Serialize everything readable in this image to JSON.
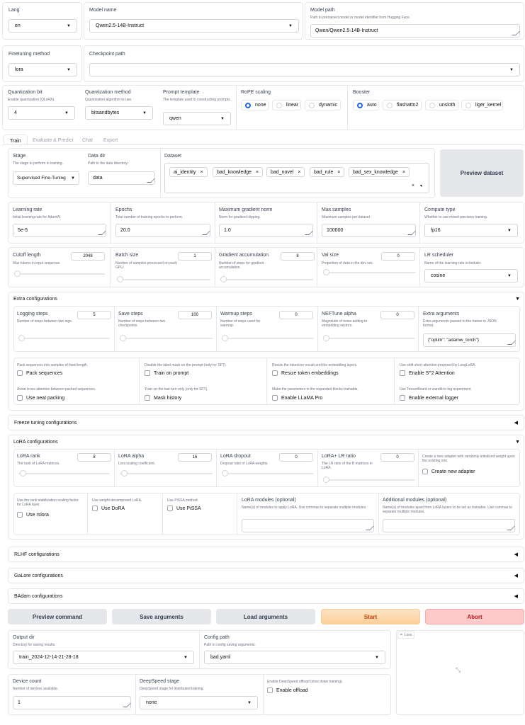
{
  "top": {
    "lang": {
      "label": "Lang",
      "value": "en"
    },
    "model_name": {
      "label": "Model name",
      "value": "Qwen2.5-14B-Instruct"
    },
    "model_path": {
      "label": "Model path",
      "desc": "Path to pretrained model or model identifier from Hugging Face.",
      "value": "Qwen/Qwen2.5-14B-Instruct"
    },
    "finetuning": {
      "label": "Finetuning method",
      "value": "lora"
    },
    "checkpoint": {
      "label": "Checkpoint path",
      "value": ""
    },
    "quant_bit": {
      "label": "Quantization bit",
      "desc": "Enable quantization (QLoRA).",
      "value": "4"
    },
    "quant_method": {
      "label": "Quantization method",
      "desc": "Quantization algorithm to use.",
      "value": "bitsandbytes"
    },
    "template": {
      "label": "Prompt template",
      "desc": "The template used in constructing prompts.",
      "value": "qwen"
    },
    "rope": {
      "label": "RoPE scaling",
      "options": [
        "none",
        "linear",
        "dynamic"
      ],
      "selected": "none"
    },
    "booster": {
      "label": "Booster",
      "options": [
        "auto",
        "flashattn2",
        "unsloth",
        "liger_kernel"
      ],
      "selected": "auto"
    }
  },
  "tabs": [
    "Train",
    "Evaluate & Predict",
    "Chat",
    "Export"
  ],
  "train": {
    "stage": {
      "label": "Stage",
      "desc": "The stage to perform in training.",
      "value": "Supervised Fine-Tuning"
    },
    "data_dir": {
      "label": "Data dir",
      "desc": "Path to the data directory.",
      "value": "data"
    },
    "dataset": {
      "label": "Dataset",
      "tags": [
        "ai_identity",
        "bad_knowledge",
        "bad_novel",
        "bad_rule",
        "bad_sex_knowledge"
      ]
    },
    "preview_dataset": "Preview dataset",
    "learning_rate": {
      "label": "Learning rate",
      "desc": "Initial learning rate for AdamW.",
      "value": "5e-5"
    },
    "epochs": {
      "label": "Epochs",
      "desc": "Total number of training epochs to perform.",
      "value": "20.0"
    },
    "max_grad_norm": {
      "label": "Maximum gradient norm",
      "desc": "Norm for gradient clipping.",
      "value": "1.0"
    },
    "max_samples": {
      "label": "Max samples",
      "desc": "Maximum samples per dataset.",
      "value": "100000"
    },
    "compute_type": {
      "label": "Compute type",
      "desc": "Whether to use mixed precision training.",
      "value": "fp16"
    },
    "cutoff_len": {
      "label": "Cutoff length",
      "desc": "Max tokens in input sequence.",
      "value": "2048"
    },
    "batch_size": {
      "label": "Batch size",
      "desc": "Number of samples processed on each GPU.",
      "value": "1"
    },
    "grad_accum": {
      "label": "Gradient accumulation",
      "desc": "Number of steps for gradient accumulation.",
      "value": "8"
    },
    "val_size": {
      "label": "Val size",
      "desc": "Proportion of data in the dev set.",
      "value": "0"
    },
    "lr_scheduler": {
      "label": "LR scheduler",
      "desc": "Name of the learning rate scheduler.",
      "value": "cosine"
    }
  },
  "extra": {
    "title": "Extra configurations",
    "logging_steps": {
      "label": "Logging steps",
      "desc": "Number of steps between two logs.",
      "value": "5"
    },
    "save_steps": {
      "label": "Save steps",
      "desc": "Number of steps between two checkpoints.",
      "value": "100"
    },
    "warmup_steps": {
      "label": "Warmup steps",
      "desc": "Number of steps used for warmup.",
      "value": "0"
    },
    "neftune": {
      "label": "NEFTune alpha",
      "desc": "Magnitude of noise adding to embedding vectors.",
      "value": "0"
    },
    "extra_args": {
      "label": "Extra arguments",
      "desc": "Extra arguments passed to the trainer in JSON format.",
      "value": "{\"optim\": \"adamw_torch\"}"
    },
    "checks": [
      {
        "desc": "Pack sequences into samples of fixed length.",
        "label": "Pack sequences"
      },
      {
        "desc": "Disable the label mask on the prompt (only for SFT).",
        "label": "Train on prompt"
      },
      {
        "desc": "Resize the tokenizer vocab and the embedding layers.",
        "label": "Resize token embeddings"
      },
      {
        "desc": "Use shift short attention proposed by LongLoRA.",
        "label": "Enable S^2 Attention"
      },
      {
        "desc": "Avoid cross attention between packed sequences.",
        "label": "Use neat packing"
      },
      {
        "desc": "Train on the last turn only (only for SFT).",
        "label": "Mask history"
      },
      {
        "desc": "Make the parameters in the expanded blocks trainable.",
        "label": "Enable LLaMA Pro"
      },
      {
        "desc": "Use TensorBoard or wandb to log experiment.",
        "label": "Enable external logger"
      }
    ]
  },
  "freeze": {
    "title": "Freeze tuning configurations"
  },
  "lora": {
    "title": "LoRA configurations",
    "rank": {
      "label": "LoRA rank",
      "desc": "The rank of LoRA matrices.",
      "value": "8"
    },
    "alpha": {
      "label": "LoRA alpha",
      "desc": "Lora scaling coefficient.",
      "value": "16"
    },
    "dropout": {
      "label": "LoRA dropout",
      "desc": "Dropout ratio of LoRA weights.",
      "value": "0"
    },
    "plus_ratio": {
      "label": "LoRA+ LR ratio",
      "desc": "The LR ratio of the B matrices in LoRA.",
      "value": "0"
    },
    "new_adapter": {
      "desc": "Create a new adapter with randomly initialized weight upon the existing one.",
      "label": "Create new adapter"
    },
    "rslora": {
      "desc": "Use the rank stabilization scaling factor for LoRA layer.",
      "label": "Use rslora"
    },
    "dora": {
      "desc": "Use weight-decomposed LoRA.",
      "label": "Use DoRA"
    },
    "pissa": {
      "desc": "Use PiSSA method.",
      "label": "Use PiSSA"
    },
    "modules": {
      "label": "LoRA modules (optional)",
      "desc": "Name(s) of modules to apply LoRA. Use commas to separate multiple modules.",
      "value": ""
    },
    "additional": {
      "label": "Additional modules (optional)",
      "desc": "Name(s) of modules apart from LoRA layers to be set as trainable. Use commas to separate multiple modules.",
      "value": ""
    }
  },
  "rlhf": {
    "title": "RLHF configurations"
  },
  "galore": {
    "title": "GaLore configurations"
  },
  "badam": {
    "title": "BAdam configurations"
  },
  "actions": {
    "preview": "Preview command",
    "save": "Save arguments",
    "load": "Load arguments",
    "start": "Start",
    "abort": "Abort"
  },
  "output": {
    "output_dir": {
      "label": "Output dir",
      "desc": "Directory for saving results.",
      "value": "train_2024-12-14-21-28-18"
    },
    "config_path": {
      "label": "Config path",
      "desc": "Path to config saving arguments.",
      "value": "bad.yaml"
    },
    "device_count": {
      "label": "Device count",
      "desc": "Number of devices available.",
      "value": "1"
    },
    "deepspeed": {
      "label": "DeepSpeed stage",
      "desc": "DeepSpeed stage for distributed training.",
      "value": "none"
    },
    "offload": {
      "desc": "Enable DeepSpeed offload (slow down training).",
      "label": "Enable offload"
    },
    "loss_label": "Loss"
  },
  "colors": {
    "accent": "#2563eb",
    "start": "#fbd5a5",
    "start_text": "#c2410c",
    "abort": "#fecaca",
    "abort_text": "#b91c1c",
    "neutral": "#e5e7eb"
  }
}
